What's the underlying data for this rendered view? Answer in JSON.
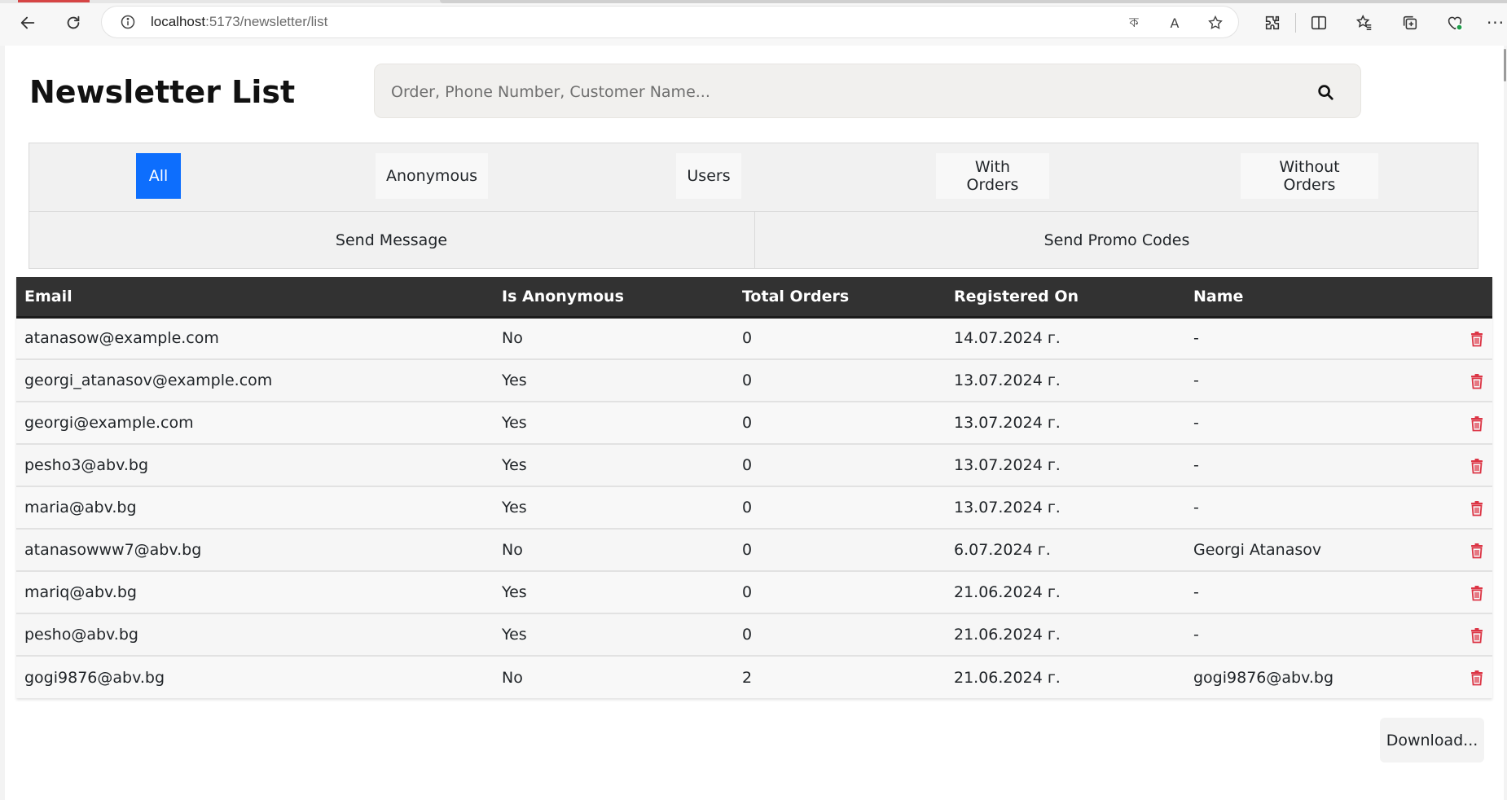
{
  "browser": {
    "url_host": "localhost",
    "url_path": ":5173/newsletter/list"
  },
  "page": {
    "title": "Newsletter List",
    "search_placeholder": "Order, Phone Number, Customer Name..."
  },
  "filters": {
    "items": [
      {
        "label": "All",
        "active": true
      },
      {
        "label": "Anonymous",
        "active": false
      },
      {
        "label": "Users",
        "active": false
      },
      {
        "label": "With Orders",
        "active": false
      },
      {
        "label": "Without Orders",
        "active": false
      }
    ]
  },
  "actions": {
    "send_message": "Send Message",
    "send_promo_codes": "Send Promo Codes"
  },
  "table": {
    "headers": [
      "Email",
      "Is Anonymous",
      "Total Orders",
      "Registered On",
      "Name"
    ],
    "rows": [
      {
        "email": "atanasow@example.com",
        "anonymous": "No",
        "orders": "0",
        "registered": "14.07.2024 г.",
        "name": "-"
      },
      {
        "email": "georgi_atanasov@example.com",
        "anonymous": "Yes",
        "orders": "0",
        "registered": "13.07.2024 г.",
        "name": "-"
      },
      {
        "email": "georgi@example.com",
        "anonymous": "Yes",
        "orders": "0",
        "registered": "13.07.2024 г.",
        "name": "-"
      },
      {
        "email": "pesho3@abv.bg",
        "anonymous": "Yes",
        "orders": "0",
        "registered": "13.07.2024 г.",
        "name": "-"
      },
      {
        "email": "maria@abv.bg",
        "anonymous": "Yes",
        "orders": "0",
        "registered": "13.07.2024 г.",
        "name": "-"
      },
      {
        "email": "atanasowww7@abv.bg",
        "anonymous": "No",
        "orders": "0",
        "registered": "6.07.2024 г.",
        "name": "Georgi Atanasov"
      },
      {
        "email": "mariq@abv.bg",
        "anonymous": "Yes",
        "orders": "0",
        "registered": "21.06.2024 г.",
        "name": "-"
      },
      {
        "email": "pesho@abv.bg",
        "anonymous": "Yes",
        "orders": "0",
        "registered": "21.06.2024 г.",
        "name": "-"
      },
      {
        "email": "gogi9876@abv.bg",
        "anonymous": "No",
        "orders": "2",
        "registered": "21.06.2024 г.",
        "name": "gogi9876@abv.bg"
      }
    ]
  },
  "download": {
    "label": "Download..."
  },
  "colors": {
    "accent": "#0d6efd",
    "table_header": "#323232",
    "delete_icon": "#dc3545"
  },
  "icons": {
    "back": "arrow-left-icon",
    "refresh": "refresh-icon",
    "info": "info-icon",
    "search": "search-icon",
    "delete": "trash-icon"
  }
}
